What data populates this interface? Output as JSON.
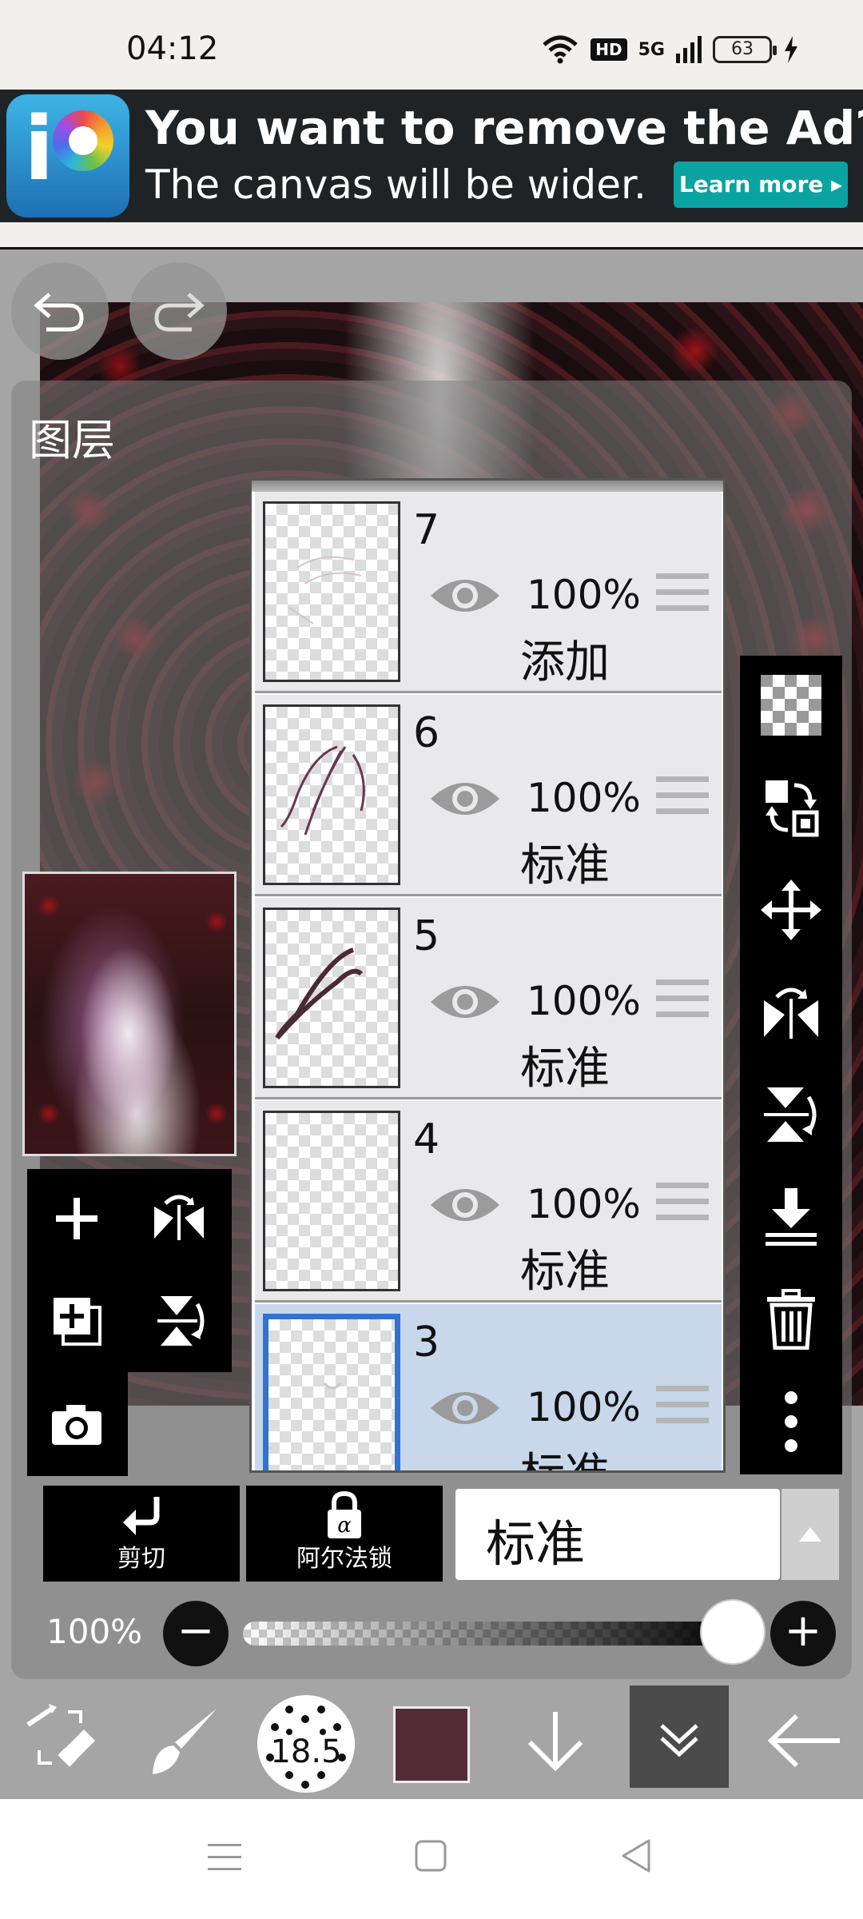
{
  "status_bar": {
    "time": "04:12",
    "network": "5G",
    "hd": "HD",
    "battery": "63"
  },
  "ad": {
    "title": "You want to remove the Ad?",
    "subtitle": "The canvas will be wider.",
    "button": "Learn more ▸",
    "logo_letter": "i"
  },
  "panel": {
    "title": "图层"
  },
  "layers": [
    {
      "number": "7",
      "opacity": "100%",
      "mode": "添加",
      "selected": false
    },
    {
      "number": "6",
      "opacity": "100%",
      "mode": "标准",
      "selected": false
    },
    {
      "number": "5",
      "opacity": "100%",
      "mode": "标准",
      "selected": false
    },
    {
      "number": "4",
      "opacity": "100%",
      "mode": "标准",
      "selected": false
    },
    {
      "number": "3",
      "opacity": "100%",
      "mode": "标准",
      "selected": true
    }
  ],
  "buttons": {
    "clip": "剪切",
    "alpha_lock": "阿尔法锁"
  },
  "blend_mode": "标准",
  "opacity": {
    "label": "100%",
    "minus": "−",
    "plus": "+",
    "level": 1.0
  },
  "toolbar": {
    "brush_size": "18.5",
    "color": "#532c38"
  },
  "colors": {
    "accent_selected": "#2f73d4",
    "ad_button": "#0aa3a2",
    "layer_selected_bg": "#c9d7eb"
  }
}
